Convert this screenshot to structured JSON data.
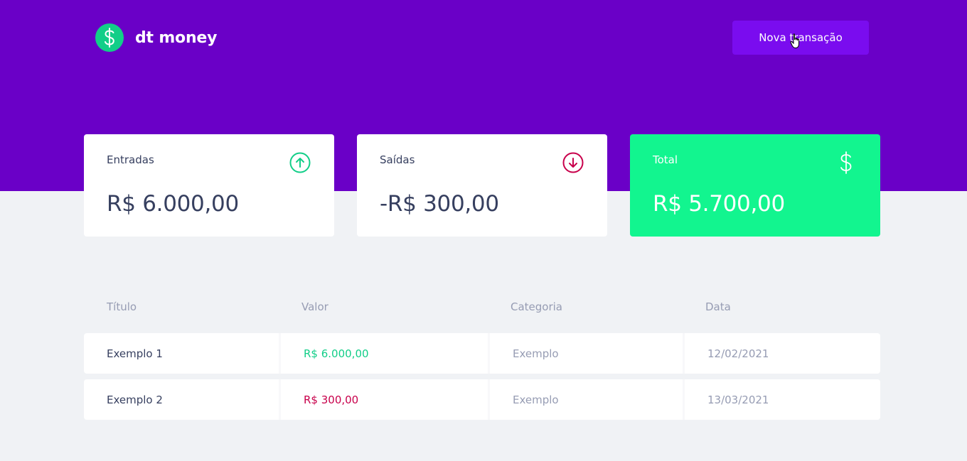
{
  "header": {
    "logo_text": "dt money",
    "new_transaction_label": "Nova transação",
    "background_color": "#6a00c7",
    "button_color": "#7a0cef"
  },
  "summary": {
    "income": {
      "label": "Entradas",
      "value": "R$ 6.000,00",
      "icon": "arrow-up-circle-icon",
      "color": "#12ce88"
    },
    "outcome": {
      "label": "Saídas",
      "value": "-R$ 300,00",
      "icon": "arrow-down-circle-icon",
      "color": "#c8004b"
    },
    "total": {
      "label": "Total",
      "value": "R$ 5.700,00",
      "icon": "dollar-sign-icon",
      "color": "#12f58f"
    }
  },
  "table": {
    "columns": [
      "Título",
      "Valor",
      "Categoria",
      "Data"
    ],
    "rows": [
      {
        "title": "Exemplo 1",
        "amount": "R$ 6.000,00",
        "type": "deposit",
        "category": "Exemplo",
        "date": "12/02/2021"
      },
      {
        "title": "Exemplo 2",
        "amount": "R$ 300,00",
        "type": "withdraw",
        "category": "Exemplo",
        "date": "13/03/2021"
      }
    ]
  }
}
